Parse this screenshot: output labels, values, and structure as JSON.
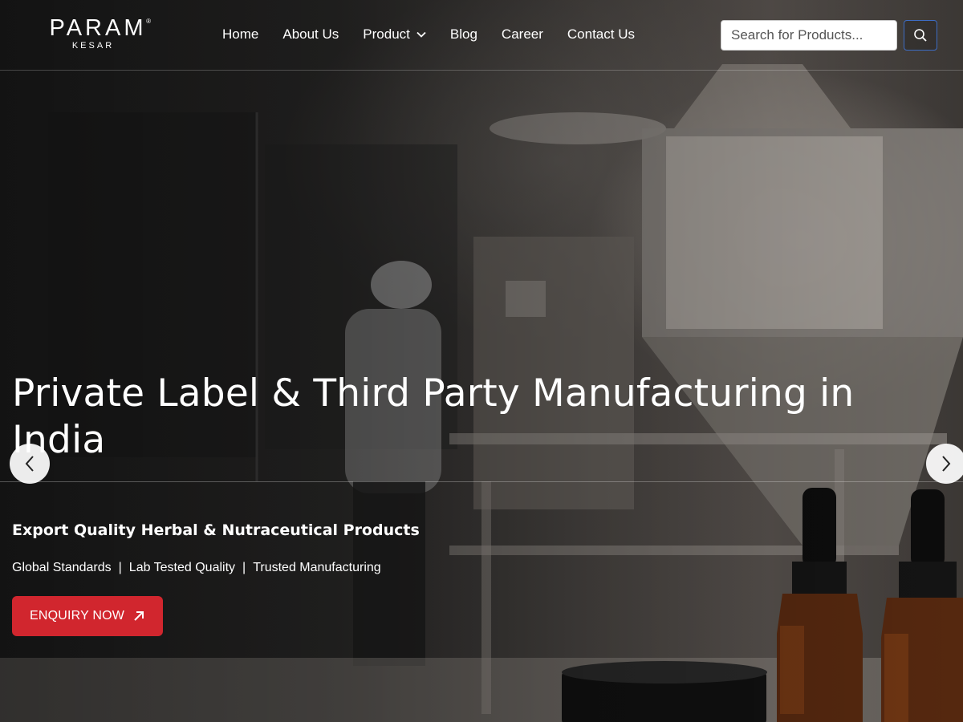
{
  "header": {
    "logo": {
      "main": "PARAM",
      "registered": "®",
      "sub": "KESAR"
    },
    "nav": [
      {
        "label": "Home"
      },
      {
        "label": "About Us"
      },
      {
        "label": "Product",
        "has_dropdown": true
      },
      {
        "label": "Blog"
      },
      {
        "label": "Career"
      },
      {
        "label": "Contact Us"
      }
    ],
    "search": {
      "placeholder": "Search for Products..."
    }
  },
  "hero": {
    "title": "Private Label & Third Party Manufacturing in India",
    "subtitle": "Export Quality Herbal & Nutraceutical Products",
    "features": [
      "Global Standards",
      "Lab Tested Quality",
      "Trusted Manufacturing"
    ],
    "cta_label": "ENQUIRY NOW"
  },
  "icons": {
    "search": "search-icon",
    "dropdown": "chevron-down-icon",
    "cta": "arrow-up-right-icon",
    "prev": "chevron-left-icon",
    "next": "chevron-right-icon"
  },
  "colors": {
    "cta": "#d1262e",
    "search_button_border": "#3d6cc2",
    "text": "#ffffff"
  }
}
